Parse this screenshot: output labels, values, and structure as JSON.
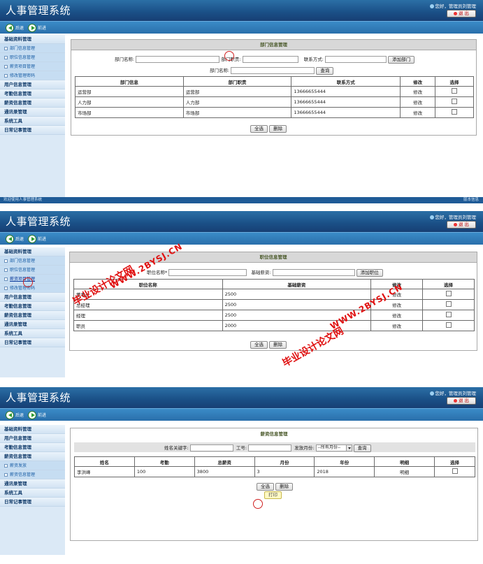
{
  "app": {
    "title": "人事管理系统",
    "greeting": "您好，管理员刘管理",
    "logout_label": "退 出",
    "back_label": "后退",
    "forward_label": "前进"
  },
  "footer": {
    "welcome": "欢迎使用人事管理系统",
    "version": "版本信息"
  },
  "screen1": {
    "sidebar": {
      "group1": "基础资料管理",
      "subs": [
        "部门信息管理",
        "职位信息管理",
        "薪资项目管理",
        "修改管理密码"
      ],
      "groups": [
        "用户信息管理",
        "考勤信息管理",
        "薪资信息管理",
        "通讯录管理",
        "系统工具",
        "日常记事管理"
      ]
    },
    "panel_title": "部门信息管理",
    "form": {
      "name_label": "部门名称:",
      "duty_label": "部门职责:",
      "contact_label": "联系方式:",
      "add_button": "添加部门",
      "search_label": "部门名称:",
      "search_button": "查询"
    },
    "columns": [
      "部门信息",
      "部门职责",
      "联系方式",
      "修改",
      "选择"
    ],
    "rows": [
      {
        "name": "运营部",
        "duty": "运营部",
        "contact": "13666655444",
        "edit": "修改"
      },
      {
        "name": "人力部",
        "duty": "人力部",
        "contact": "13666655444",
        "edit": "修改"
      },
      {
        "name": "市场部",
        "duty": "市场部",
        "contact": "13666655444",
        "edit": "修改"
      }
    ],
    "select_all": "全选",
    "delete": "删除"
  },
  "screen2": {
    "sidebar": {
      "group1": "基础资料管理",
      "subs": [
        "部门信息管理",
        "职位信息管理",
        "薪资项目管理",
        "修改管理密码"
      ],
      "groups": [
        "用户信息管理",
        "考勤信息管理",
        "薪资信息管理",
        "通讯录管理",
        "系统工具",
        "日常记事管理"
      ]
    },
    "panel_title": "职位信息管理",
    "form": {
      "name_label": "职位名称*",
      "salary_label": "基础薪资:",
      "add_button": "添加职位"
    },
    "columns": [
      "职位名称",
      "基础薪资",
      "修改",
      "选择"
    ],
    "rows": [
      {
        "name": "董事长",
        "salary": "2500",
        "edit": "修改"
      },
      {
        "name": "总经理",
        "salary": "2500",
        "edit": "修改"
      },
      {
        "name": "经理",
        "salary": "2500",
        "edit": "修改"
      },
      {
        "name": "职员",
        "salary": "2000",
        "edit": "修改"
      }
    ],
    "select_all": "全选",
    "delete": "删除",
    "watermark_cn": "毕业设计论文网",
    "watermark_url": "WWW.2BYSJ.CN"
  },
  "screen3": {
    "sidebar": {
      "groups_top": [
        "基础资料管理",
        "用户信息管理",
        "考勤信息管理",
        "薪资信息管理"
      ],
      "subs": [
        "薪资发放",
        "薪资信息管理"
      ],
      "groups_bottom": [
        "通讯录管理",
        "系统工具",
        "日常记事管理"
      ]
    },
    "panel_title": "薪资信息管理",
    "form": {
      "name_label": "姓名关键字:",
      "id_label": "工号:",
      "month_label": "发放月份:",
      "month_value": "--所有月份--",
      "search_button": "查询"
    },
    "columns": [
      "姓名",
      "考勤",
      "总薪资",
      "月份",
      "年份",
      "明细",
      "选择"
    ],
    "rows": [
      {
        "name": "李洪峰",
        "attendance": "100",
        "total": "3800",
        "month": "3",
        "year": "2018",
        "detail": "明细"
      }
    ],
    "select_all": "全选",
    "delete": "删除",
    "print": "打印"
  }
}
